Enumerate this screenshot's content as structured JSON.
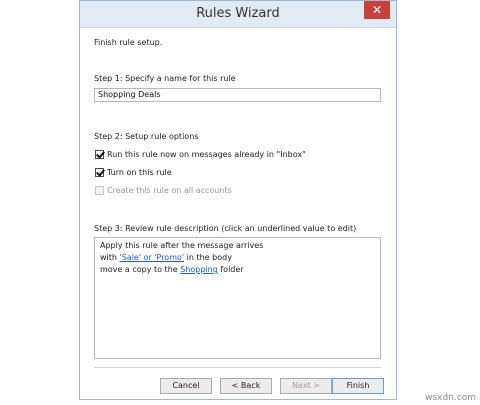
{
  "window": {
    "title": "Rules Wizard",
    "close_glyph": "✕"
  },
  "intro": "Finish rule setup.",
  "step1": {
    "label": "Step 1: Specify a name for this rule",
    "name_value": "Shopping Deals"
  },
  "step2": {
    "label": "Step 2: Setup rule options",
    "options": [
      {
        "label": "Run this rule now on messages already in \"Inbox\"",
        "checked": true,
        "enabled": true
      },
      {
        "label": "Turn on this rule",
        "checked": true,
        "enabled": true
      },
      {
        "label": "Create this rule on all accounts",
        "checked": false,
        "enabled": false
      }
    ]
  },
  "step3": {
    "label": "Step 3: Review rule description (click an underlined value to edit)",
    "line1": "Apply this rule after the message arrives",
    "line2_prefix": "with ",
    "line2_link": "'Sale' or 'Promo'",
    "line2_suffix": " in the body",
    "line3_prefix": "move a copy to the ",
    "line3_link": "Shopping",
    "line3_suffix": " folder"
  },
  "buttons": {
    "cancel": "Cancel",
    "back": "< Back",
    "next": "Next >",
    "finish": "Finish"
  },
  "watermark": "wsxdn.com",
  "colors": {
    "titlebar": "#e2eaf3",
    "close": "#c7423d",
    "link": "#1f5fbf"
  }
}
